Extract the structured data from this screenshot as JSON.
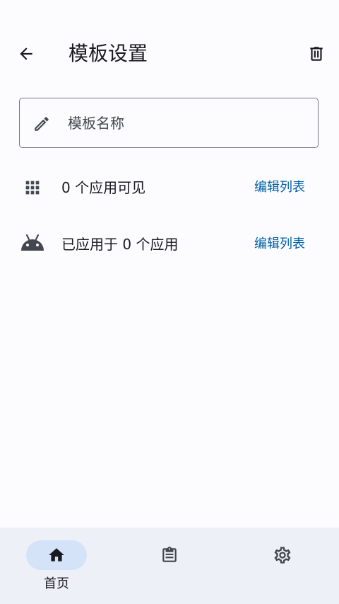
{
  "header": {
    "title": "模板设置",
    "back_icon": "arrow-back-icon",
    "delete_icon": "delete-icon"
  },
  "name_field": {
    "placeholder": "模板名称",
    "value": "",
    "icon": "pencil-icon"
  },
  "rows": [
    {
      "icon": "apps-grid-icon",
      "label": "0 个应用可见",
      "action": "编辑列表"
    },
    {
      "icon": "android-icon",
      "label": "已应用于 0 个应用",
      "action": "编辑列表"
    }
  ],
  "bottom_nav": {
    "items": [
      {
        "icon": "home-icon",
        "label": "首页",
        "active": true
      },
      {
        "icon": "clipboard-icon",
        "label": "",
        "active": false
      },
      {
        "icon": "gear-icon",
        "label": "",
        "active": false
      }
    ]
  },
  "colors": {
    "accent": "#0061a4",
    "nav_active_bg": "#d4e3f8",
    "nav_bg": "#eef0f8",
    "background": "#fcfcff"
  }
}
